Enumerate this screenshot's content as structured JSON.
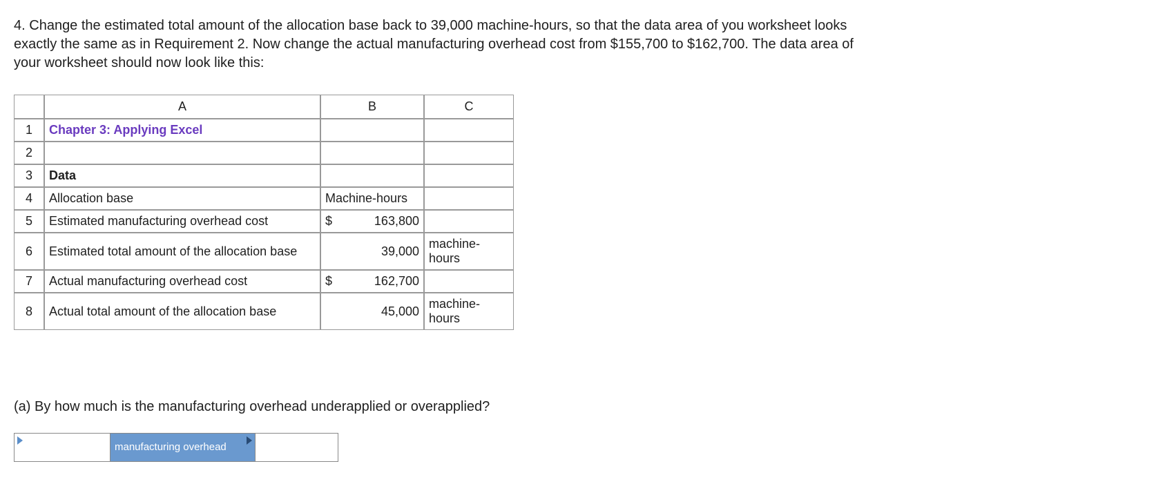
{
  "question": {
    "number": "4.",
    "text": "Change the estimated total amount of the allocation base back to 39,000 machine-hours, so that the data area of you worksheet looks exactly the same as in Requirement 2. Now change the actual manufacturing overhead cost from $155,700 to $162,700. The data area of your worksheet should now look like this:"
  },
  "spreadsheet": {
    "col_headers": {
      "a": "A",
      "b": "B",
      "c": "C"
    },
    "rows": [
      {
        "n": "1",
        "a": "Chapter 3: Applying Excel",
        "a_class": "purple",
        "b": "",
        "c": ""
      },
      {
        "n": "2",
        "a": "",
        "b": "",
        "c": ""
      },
      {
        "n": "3",
        "a": "Data",
        "a_class": "bold",
        "b": "",
        "c": ""
      },
      {
        "n": "4",
        "a": "Allocation base",
        "b": "Machine-hours",
        "c": ""
      },
      {
        "n": "5",
        "a": "Estimated manufacturing overhead cost",
        "b_currency": "$",
        "b_value": "163,800",
        "c": ""
      },
      {
        "n": "6",
        "a": "Estimated total amount of the allocation base",
        "b_value": "39,000",
        "c": "machine-hours"
      },
      {
        "n": "7",
        "a": "Actual manufacturing overhead cost",
        "b_currency": "$",
        "b_value": "162,700",
        "c": ""
      },
      {
        "n": "8",
        "a": "Actual total amount of the allocation base",
        "b_value": "45,000",
        "c": "machine-hours"
      }
    ]
  },
  "sub_question": "(a) By how much is the manufacturing overhead underapplied or overapplied?",
  "answer": {
    "dropdown_value": "",
    "label": "manufacturing overhead",
    "input_value": ""
  }
}
